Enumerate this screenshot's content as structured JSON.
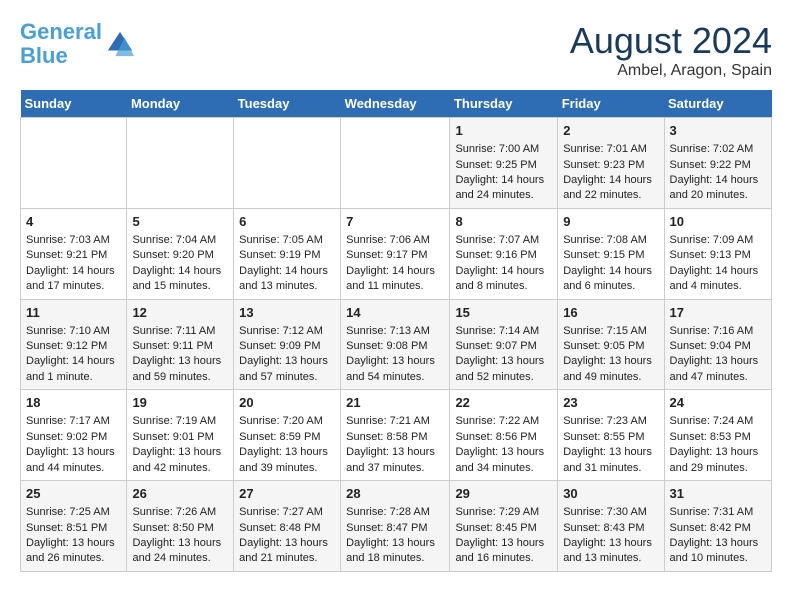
{
  "header": {
    "logo_line1": "General",
    "logo_line2": "Blue",
    "month_title": "August 2024",
    "location": "Ambel, Aragon, Spain"
  },
  "days_of_week": [
    "Sunday",
    "Monday",
    "Tuesday",
    "Wednesday",
    "Thursday",
    "Friday",
    "Saturday"
  ],
  "weeks": [
    [
      {
        "day": "",
        "content": ""
      },
      {
        "day": "",
        "content": ""
      },
      {
        "day": "",
        "content": ""
      },
      {
        "day": "",
        "content": ""
      },
      {
        "day": "1",
        "content": "Sunrise: 7:00 AM\nSunset: 9:25 PM\nDaylight: 14 hours\nand 24 minutes."
      },
      {
        "day": "2",
        "content": "Sunrise: 7:01 AM\nSunset: 9:23 PM\nDaylight: 14 hours\nand 22 minutes."
      },
      {
        "day": "3",
        "content": "Sunrise: 7:02 AM\nSunset: 9:22 PM\nDaylight: 14 hours\nand 20 minutes."
      }
    ],
    [
      {
        "day": "4",
        "content": "Sunrise: 7:03 AM\nSunset: 9:21 PM\nDaylight: 14 hours\nand 17 minutes."
      },
      {
        "day": "5",
        "content": "Sunrise: 7:04 AM\nSunset: 9:20 PM\nDaylight: 14 hours\nand 15 minutes."
      },
      {
        "day": "6",
        "content": "Sunrise: 7:05 AM\nSunset: 9:19 PM\nDaylight: 14 hours\nand 13 minutes."
      },
      {
        "day": "7",
        "content": "Sunrise: 7:06 AM\nSunset: 9:17 PM\nDaylight: 14 hours\nand 11 minutes."
      },
      {
        "day": "8",
        "content": "Sunrise: 7:07 AM\nSunset: 9:16 PM\nDaylight: 14 hours\nand 8 minutes."
      },
      {
        "day": "9",
        "content": "Sunrise: 7:08 AM\nSunset: 9:15 PM\nDaylight: 14 hours\nand 6 minutes."
      },
      {
        "day": "10",
        "content": "Sunrise: 7:09 AM\nSunset: 9:13 PM\nDaylight: 14 hours\nand 4 minutes."
      }
    ],
    [
      {
        "day": "11",
        "content": "Sunrise: 7:10 AM\nSunset: 9:12 PM\nDaylight: 14 hours\nand 1 minute."
      },
      {
        "day": "12",
        "content": "Sunrise: 7:11 AM\nSunset: 9:11 PM\nDaylight: 13 hours\nand 59 minutes."
      },
      {
        "day": "13",
        "content": "Sunrise: 7:12 AM\nSunset: 9:09 PM\nDaylight: 13 hours\nand 57 minutes."
      },
      {
        "day": "14",
        "content": "Sunrise: 7:13 AM\nSunset: 9:08 PM\nDaylight: 13 hours\nand 54 minutes."
      },
      {
        "day": "15",
        "content": "Sunrise: 7:14 AM\nSunset: 9:07 PM\nDaylight: 13 hours\nand 52 minutes."
      },
      {
        "day": "16",
        "content": "Sunrise: 7:15 AM\nSunset: 9:05 PM\nDaylight: 13 hours\nand 49 minutes."
      },
      {
        "day": "17",
        "content": "Sunrise: 7:16 AM\nSunset: 9:04 PM\nDaylight: 13 hours\nand 47 minutes."
      }
    ],
    [
      {
        "day": "18",
        "content": "Sunrise: 7:17 AM\nSunset: 9:02 PM\nDaylight: 13 hours\nand 44 minutes."
      },
      {
        "day": "19",
        "content": "Sunrise: 7:19 AM\nSunset: 9:01 PM\nDaylight: 13 hours\nand 42 minutes."
      },
      {
        "day": "20",
        "content": "Sunrise: 7:20 AM\nSunset: 8:59 PM\nDaylight: 13 hours\nand 39 minutes."
      },
      {
        "day": "21",
        "content": "Sunrise: 7:21 AM\nSunset: 8:58 PM\nDaylight: 13 hours\nand 37 minutes."
      },
      {
        "day": "22",
        "content": "Sunrise: 7:22 AM\nSunset: 8:56 PM\nDaylight: 13 hours\nand 34 minutes."
      },
      {
        "day": "23",
        "content": "Sunrise: 7:23 AM\nSunset: 8:55 PM\nDaylight: 13 hours\nand 31 minutes."
      },
      {
        "day": "24",
        "content": "Sunrise: 7:24 AM\nSunset: 8:53 PM\nDaylight: 13 hours\nand 29 minutes."
      }
    ],
    [
      {
        "day": "25",
        "content": "Sunrise: 7:25 AM\nSunset: 8:51 PM\nDaylight: 13 hours\nand 26 minutes."
      },
      {
        "day": "26",
        "content": "Sunrise: 7:26 AM\nSunset: 8:50 PM\nDaylight: 13 hours\nand 24 minutes."
      },
      {
        "day": "27",
        "content": "Sunrise: 7:27 AM\nSunset: 8:48 PM\nDaylight: 13 hours\nand 21 minutes."
      },
      {
        "day": "28",
        "content": "Sunrise: 7:28 AM\nSunset: 8:47 PM\nDaylight: 13 hours\nand 18 minutes."
      },
      {
        "day": "29",
        "content": "Sunrise: 7:29 AM\nSunset: 8:45 PM\nDaylight: 13 hours\nand 16 minutes."
      },
      {
        "day": "30",
        "content": "Sunrise: 7:30 AM\nSunset: 8:43 PM\nDaylight: 13 hours\nand 13 minutes."
      },
      {
        "day": "31",
        "content": "Sunrise: 7:31 AM\nSunset: 8:42 PM\nDaylight: 13 hours\nand 10 minutes."
      }
    ]
  ]
}
